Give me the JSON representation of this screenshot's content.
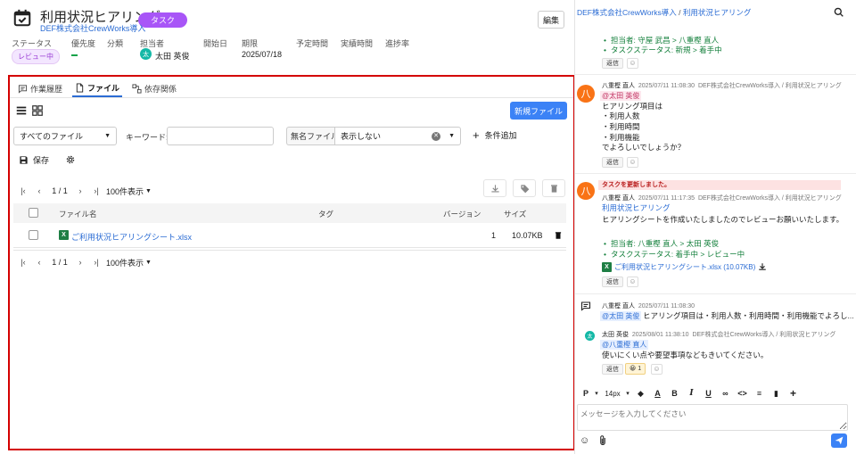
{
  "header": {
    "title": "利用状況ヒアリング",
    "badge": "タスク",
    "subtitle": "DEF株式会社CrewWorks導入",
    "edit_label": "編集"
  },
  "meta": {
    "labels": [
      "ステータス",
      "優先度",
      "分類",
      "担当者",
      "開始日",
      "期限",
      "予定時間",
      "実績時間",
      "進捗率"
    ],
    "status": "レビュー中",
    "assignee_initial": "太",
    "assignee": "太田 英俊",
    "due": "2025/07/18"
  },
  "tabs": [
    "作業履歴",
    "ファイル",
    "依存関係"
  ],
  "toolbar": {
    "new_file": "新規ファイル",
    "file_filter": "すべてのファイル",
    "keyword_label": "キーワード:",
    "keyword_value": "",
    "anon_label": "無名ファイル:",
    "anon_value": "表示しない",
    "add_condition": "条件追加",
    "save": "保存"
  },
  "pager": {
    "page": "1 / 1",
    "per_page": "100件表示"
  },
  "table": {
    "columns": [
      "ファイル名",
      "タグ",
      "バージョン",
      "サイズ"
    ],
    "rows": [
      {
        "name": "ご利用状況ヒアリングシート.xlsx",
        "tag": "",
        "version": "1",
        "size": "10.07KB"
      }
    ]
  },
  "chat": {
    "breadcrumb_project": "DEF株式会社CrewWorks導入",
    "breadcrumb_sep": "/",
    "breadcrumb_task": "利用状況ヒアリング",
    "reply_label": "返信",
    "top_items": [
      "担当者: 守屋 武昌 > 八重樫 直人",
      "タスクステータス: 新規 > 着手中"
    ],
    "msg1": {
      "initial": "八",
      "author": "八重樫 直人",
      "time": "2025/07/11 11:08:30",
      "path": "DEF株式会社CrewWorks導入 / 利用状況ヒアリング",
      "mention": "@太田 英俊",
      "lines": [
        "ヒアリング項目は",
        "・利用人数",
        "・利用時間",
        "・利用機能",
        "でよろしいでしょうか？"
      ]
    },
    "msg2": {
      "notice": "タスクを更新しました。",
      "initial": "八",
      "author": "八重樫 直人",
      "time": "2025/07/11 11:17:35",
      "path": "DEF株式会社CrewWorks導入 / 利用状況ヒアリング",
      "task_link": "利用状況ヒアリング",
      "text": "ヒアリングシートを作成いたしましたのでレビューお願いいたします。",
      "items": [
        "担当者: 八重樫 直人 > 太田 英俊",
        "タスクステータス: 着手中 > レビュー中"
      ],
      "file": "ご利用状況ヒアリングシート.xlsx (10.07KB)"
    },
    "thread": {
      "author": "八重樫 直人",
      "time": "2025/07/11 11:08:30",
      "mention": "@太田 英俊",
      "summary": "ヒアリング項目は・利用人数・利用時間・利用機能でよろし...",
      "reply_initial": "太",
      "reply_author": "太田 英俊",
      "reply_time": "2025/08/01 11:38:10",
      "reply_path": "DEF株式会社CrewWorks導入 / 利用状況ヒアリング",
      "reply_mention": "@八重樫 直人",
      "reply_text": "使いにくい点や要望事項などもきいてください。",
      "reaction": "😀 1"
    },
    "editor": {
      "paragraph": "P",
      "font_size": "14px",
      "placeholder": "メッセージを入力してください"
    }
  },
  "colors": {
    "accent": "#3b82f6",
    "badge_purple": "#a855f7",
    "highlight_border": "#d40000",
    "green": "#15803d",
    "excel": "#1e7e44"
  }
}
